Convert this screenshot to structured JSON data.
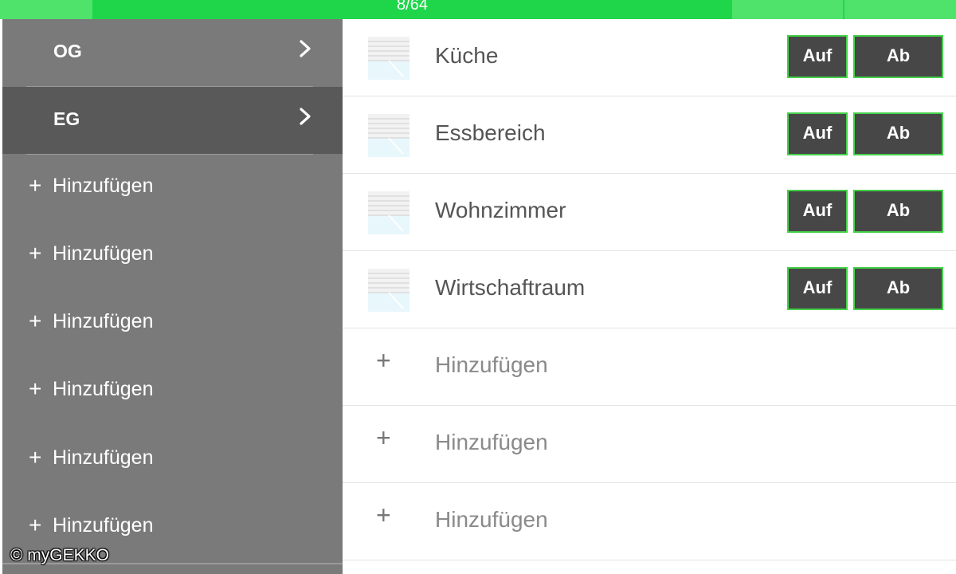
{
  "progress": {
    "label": "8/64",
    "value": 8,
    "total": 64
  },
  "sidebar": {
    "floors": [
      {
        "label": "OG",
        "icon": "chevron-right-icon"
      },
      {
        "label": "EG",
        "icon": "chevron-right-icon",
        "selected": true
      }
    ],
    "add_items": [
      {
        "icon": "plus-icon",
        "label": "Hinzufügen"
      },
      {
        "icon": "plus-icon",
        "label": "Hinzufügen"
      },
      {
        "icon": "plus-icon",
        "label": "Hinzufügen"
      },
      {
        "icon": "plus-icon",
        "label": "Hinzufügen"
      },
      {
        "icon": "plus-icon",
        "label": "Hinzufügen"
      },
      {
        "icon": "plus-icon",
        "label": "Hinzufügen"
      }
    ],
    "plus_glyph": "+"
  },
  "rooms": [
    {
      "name": "Küche",
      "up_label": "Auf",
      "down_label": "Ab",
      "icon": "blind-icon"
    },
    {
      "name": "Essbereich",
      "up_label": "Auf",
      "down_label": "Ab",
      "icon": "blind-icon"
    },
    {
      "name": "Wohnzimmer",
      "up_label": "Auf",
      "down_label": "Ab",
      "icon": "blind-icon"
    },
    {
      "name": "Wirtschaftraum",
      "up_label": "Auf",
      "down_label": "Ab",
      "icon": "blind-icon"
    }
  ],
  "add_rows": [
    {
      "icon": "plus-icon",
      "label": "Hinzufügen"
    },
    {
      "icon": "plus-icon",
      "label": "Hinzufügen"
    },
    {
      "icon": "plus-icon",
      "label": "Hinzufügen"
    }
  ],
  "watermark": "© myGEKKO",
  "colors": {
    "accent_green": "#1fd64a",
    "progress_track": "#4fe36b",
    "sidebar_bg": "#7a7a7a",
    "sidebar_selected": "#595959",
    "button_bg": "#474747",
    "button_border": "#45d14a"
  }
}
